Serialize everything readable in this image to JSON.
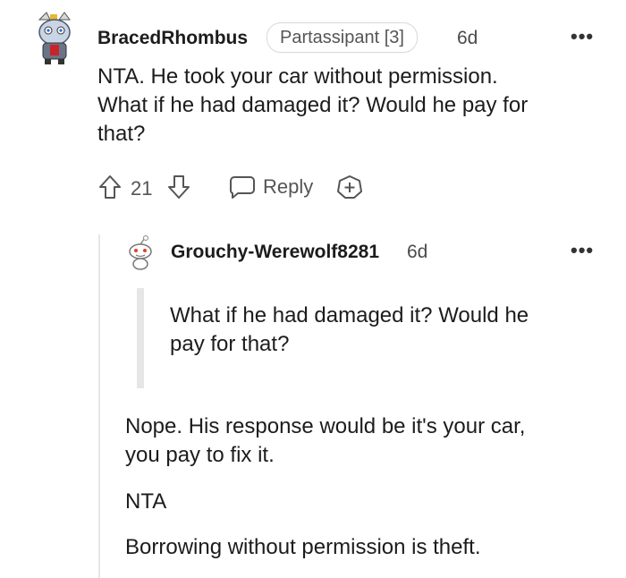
{
  "comment": {
    "author": "BracedRhombus",
    "flair": "Partassipant [3]",
    "time": "6d",
    "more_label": "•••",
    "lines": [
      "NTA. He took your car without permission.",
      "What if he had damaged it? Would he pay for",
      "that?"
    ],
    "score": "21",
    "reply_label": "Reply",
    "icons": [
      "avatar-knight",
      "upvote-icon",
      "downvote-icon",
      "reply-icon",
      "award-icon",
      "more-icon"
    ]
  },
  "reply": {
    "author": "Grouchy-Werewolf8281",
    "time": "6d",
    "more_label": "•••",
    "quote_lines": [
      "What if he had damaged it? Would he",
      "pay for that?"
    ],
    "para1_lines": [
      "Nope. His response would be it's your car,",
      "you pay to fix it."
    ],
    "para2": "NTA",
    "para3": "Borrowing without permission is theft.",
    "icons": [
      "avatar-snoo",
      "more-icon"
    ]
  }
}
